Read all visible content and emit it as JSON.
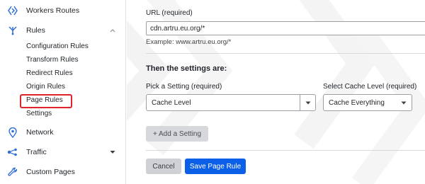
{
  "sidebar": {
    "workers_routes": {
      "label": "Workers Routes",
      "icon": "workers-diamond-icon"
    },
    "rules": {
      "label": "Rules",
      "icon": "rules-fork-icon",
      "expanded": true,
      "items": [
        {
          "label": "Configuration Rules"
        },
        {
          "label": "Transform Rules"
        },
        {
          "label": "Redirect Rules"
        },
        {
          "label": "Origin Rules"
        },
        {
          "label": "Page Rules",
          "highlighted": true
        },
        {
          "label": "Settings"
        }
      ]
    },
    "network": {
      "label": "Network",
      "icon": "location-pin-icon"
    },
    "traffic": {
      "label": "Traffic",
      "icon": "traffic-nodes-icon"
    },
    "custom_pages": {
      "label": "Custom Pages",
      "icon": "wrench-icon"
    }
  },
  "form": {
    "url_label": "URL (required)",
    "url_value": "cdn.artru.eu.org/*",
    "url_example": "Example: www.artru.eu.org/*",
    "settings_heading": "Then the settings are:",
    "pick_setting_label": "Pick a Setting (required)",
    "pick_setting_value": "Cache Level",
    "cache_level_label": "Select Cache Level (required)",
    "cache_level_value": "Cache Everything",
    "add_setting_label": "+ Add a Setting",
    "cancel_label": "Cancel",
    "save_label": "Save Page Rule"
  },
  "colors": {
    "highlight": "#e0232a",
    "primary_button": "#0c5fe7",
    "nav_icon": "#2f6fd6"
  }
}
